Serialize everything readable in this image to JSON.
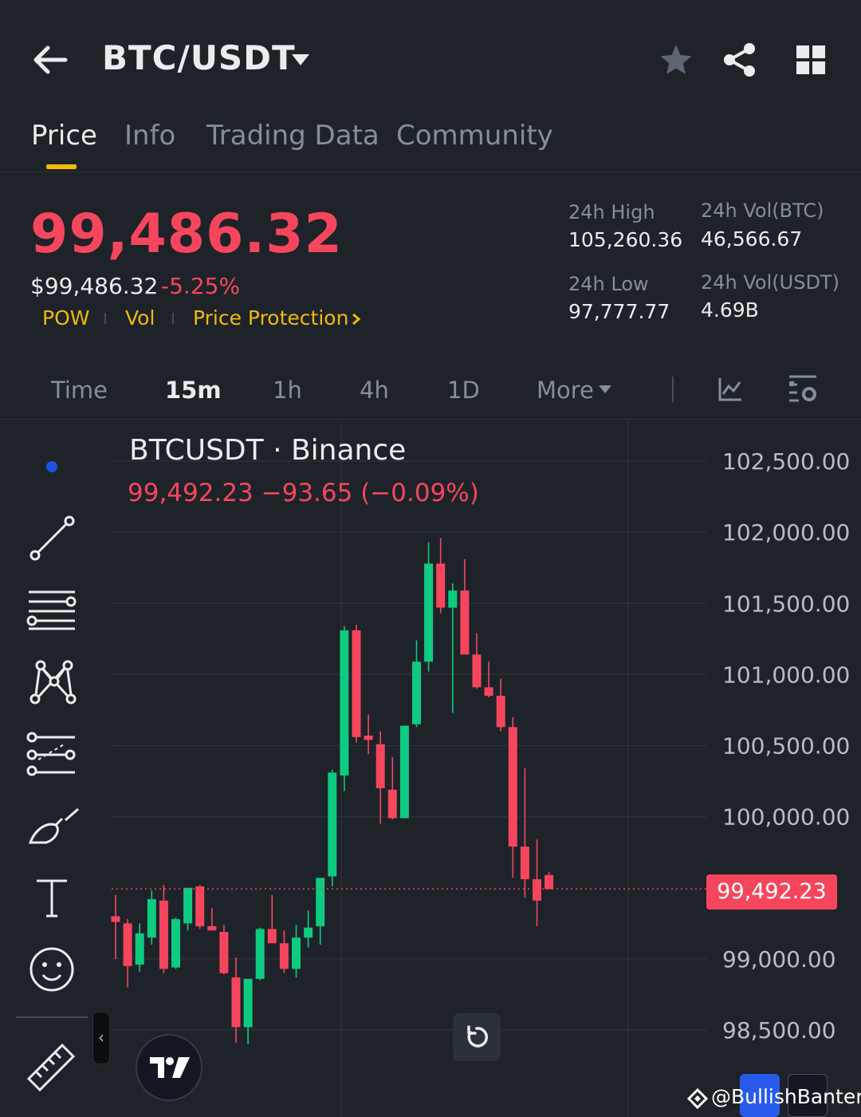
{
  "header": {
    "pair": "BTC/USDT",
    "tabs": [
      "Price",
      "Info",
      "Trading Data",
      "Community"
    ],
    "active_tab": "Price"
  },
  "price": {
    "last": "99,486.32",
    "usd": "$99,486.32",
    "change_pct": "-5.25%",
    "tags": [
      "POW",
      "Vol",
      "Price Protection"
    ]
  },
  "stats": {
    "high_label": "24h High",
    "high": "105,260.36",
    "low_label": "24h Low",
    "low": "97,777.77",
    "vol_btc_label": "24h Vol(BTC)",
    "vol_btc": "46,566.67",
    "vol_usdt_label": "24h Vol(USDT)",
    "vol_usdt": "4.69B"
  },
  "intervals": {
    "items": [
      "Time",
      "15m",
      "1h",
      "4h",
      "1D",
      "More"
    ],
    "active": "15m"
  },
  "colors": {
    "up": "#0ecb81",
    "down": "#f6465d",
    "accent": "#f0b90b"
  },
  "chart_data": {
    "type": "candlestick",
    "title": "BTCUSDT · Binance",
    "ohlc_readout": "99,492.23  −93.65 (−0.09%)",
    "current_price": 99492.23,
    "current_price_label": "99,492.23",
    "ylim": [
      98200,
      102700
    ],
    "y_ticks": [
      102500,
      102000,
      101500,
      101000,
      100500,
      100000,
      99000,
      98500
    ],
    "y_tick_labels": [
      "102,500.00",
      "102,000.00",
      "101,500.00",
      "101,000.00",
      "100,500.00",
      "100,000.00",
      "99,000.00",
      "98,500.00"
    ],
    "candles": [
      {
        "o": 99300,
        "h": 99450,
        "l": 99000,
        "c": 99260
      },
      {
        "o": 99250,
        "h": 99280,
        "l": 98800,
        "c": 98950
      },
      {
        "o": 98960,
        "h": 99250,
        "l": 98910,
        "c": 99180
      },
      {
        "o": 99150,
        "h": 99480,
        "l": 99100,
        "c": 99420
      },
      {
        "o": 99410,
        "h": 99520,
        "l": 98900,
        "c": 98930
      },
      {
        "o": 98940,
        "h": 99290,
        "l": 98930,
        "c": 99280
      },
      {
        "o": 99250,
        "h": 99490,
        "l": 99200,
        "c": 99500
      },
      {
        "o": 99510,
        "h": 99520,
        "l": 99210,
        "c": 99230
      },
      {
        "o": 99230,
        "h": 99360,
        "l": 99210,
        "c": 99200
      },
      {
        "o": 99190,
        "h": 99240,
        "l": 98890,
        "c": 98900
      },
      {
        "o": 98870,
        "h": 99010,
        "l": 98410,
        "c": 98520
      },
      {
        "o": 98520,
        "h": 98800,
        "l": 98400,
        "c": 98860
      },
      {
        "o": 98860,
        "h": 99220,
        "l": 98850,
        "c": 99210
      },
      {
        "o": 99210,
        "h": 99450,
        "l": 99120,
        "c": 99110
      },
      {
        "o": 99110,
        "h": 99200,
        "l": 98900,
        "c": 98930
      },
      {
        "o": 98930,
        "h": 99240,
        "l": 98870,
        "c": 99150
      },
      {
        "o": 99150,
        "h": 99340,
        "l": 99080,
        "c": 99220
      },
      {
        "o": 99230,
        "h": 99340,
        "l": 99100,
        "c": 99570
      },
      {
        "o": 99580,
        "h": 100330,
        "l": 99510,
        "c": 100310
      },
      {
        "o": 100290,
        "h": 101340,
        "l": 100180,
        "c": 101310
      },
      {
        "o": 101310,
        "h": 101350,
        "l": 100520,
        "c": 100560
      },
      {
        "o": 100570,
        "h": 100720,
        "l": 100440,
        "c": 100540
      },
      {
        "o": 100510,
        "h": 100600,
        "l": 99950,
        "c": 100200
      },
      {
        "o": 100190,
        "h": 100420,
        "l": 99980,
        "c": 99990
      },
      {
        "o": 99990,
        "h": 100530,
        "l": 99990,
        "c": 100640
      },
      {
        "o": 100650,
        "h": 101240,
        "l": 100630,
        "c": 101090
      },
      {
        "o": 101090,
        "h": 101930,
        "l": 101020,
        "c": 101780
      },
      {
        "o": 101780,
        "h": 101960,
        "l": 101430,
        "c": 101470
      },
      {
        "o": 101470,
        "h": 101640,
        "l": 100730,
        "c": 101590
      },
      {
        "o": 101590,
        "h": 101810,
        "l": 101140,
        "c": 101140
      },
      {
        "o": 101140,
        "h": 101290,
        "l": 100900,
        "c": 100910
      },
      {
        "o": 100910,
        "h": 101090,
        "l": 100840,
        "c": 100850
      },
      {
        "o": 100850,
        "h": 100970,
        "l": 100600,
        "c": 100630
      },
      {
        "o": 100630,
        "h": 100700,
        "l": 99570,
        "c": 99790
      },
      {
        "o": 99790,
        "h": 100340,
        "l": 99430,
        "c": 99560
      },
      {
        "o": 99560,
        "h": 99840,
        "l": 99230,
        "c": 99410
      },
      {
        "o": 99590,
        "h": 99610,
        "l": 99490,
        "c": 99490
      }
    ]
  },
  "watermark": "@BullishBanter"
}
